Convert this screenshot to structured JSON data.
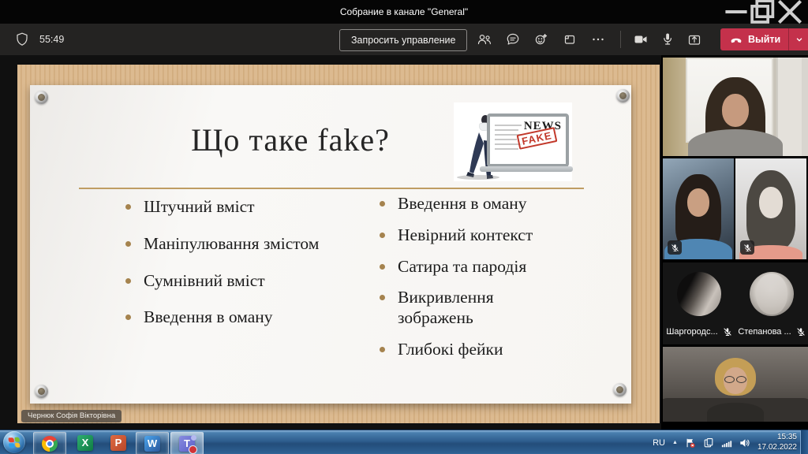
{
  "titlebar": {
    "title": "Собрание в канале \"General\""
  },
  "toolbar": {
    "timer": "55:49",
    "request_control_label": "Запросить управление",
    "leave_label": "Выйти"
  },
  "slide": {
    "title": "Що таке fake?",
    "illustration": {
      "news_label": "NEWS",
      "fake_label": "FAKE"
    },
    "left_bullets": [
      "Штучний вміст",
      "Маніпулювання змістом",
      "Сумнівний вміст",
      "Введення в оману"
    ],
    "right_bullets": [
      "Введення в оману",
      "Невірний контекст",
      "Сатира та пародія",
      "Викривлення зображень",
      "Глибокі фейки"
    ],
    "presenter_label": "Чернюк Софія Вікторівна"
  },
  "sidebar": {
    "participants": [
      {
        "name": "Шаргородс...",
        "muted": true
      },
      {
        "name": "Степанова ...",
        "muted": true
      }
    ]
  },
  "taskbar": {
    "language": "RU",
    "time": "15:35",
    "date": "17.02.2022",
    "apps": [
      {
        "name": "start"
      },
      {
        "name": "chrome",
        "open": true
      },
      {
        "name": "excel",
        "letter": "X",
        "open": false
      },
      {
        "name": "powerpoint",
        "letter": "P",
        "open": false
      },
      {
        "name": "word",
        "letter": "W",
        "open": true
      },
      {
        "name": "teams",
        "letter": "T",
        "open": true,
        "active": true
      }
    ]
  },
  "colors": {
    "teams_red": "#c4314b",
    "board_tan": "#d8b68a",
    "accent_gold": "#bf9d63",
    "taskbar_blue": "#2d5c8c",
    "bullet_dot": "#a5834e"
  }
}
